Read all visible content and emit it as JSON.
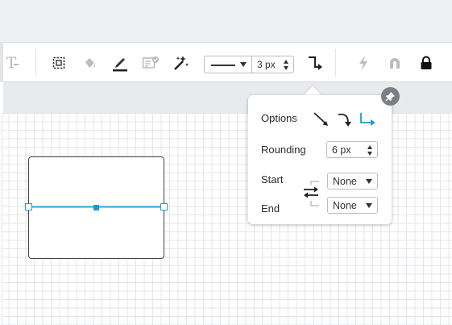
{
  "toolbar": {
    "text_tool_label": "T",
    "line_style_value": "solid",
    "line_width_value": "3 px",
    "icons": [
      "text-icon",
      "crop-icon",
      "fill-bucket-icon",
      "line-color-pen-icon",
      "checklist-icon",
      "magic-wand-icon",
      "line-style-dropdown",
      "line-width-stepper",
      "connector-icon",
      "lightning-icon",
      "magnet-icon",
      "lock-icon"
    ]
  },
  "line_options_popup": {
    "options_label": "Options",
    "option_icons": [
      "straight-line-icon",
      "curved-line-icon",
      "elbow-line-icon"
    ],
    "selected_option": "elbow",
    "rounding_label": "Rounding",
    "rounding_value": "6 px",
    "start_label": "Start",
    "start_value": "None",
    "end_label": "End",
    "end_value": "None",
    "swap_icon": "swap-arrows-icon",
    "pin_icon": "pin-icon"
  },
  "colors": {
    "accent": "#1d9bd1",
    "selection_line": "#2aa4cf"
  }
}
